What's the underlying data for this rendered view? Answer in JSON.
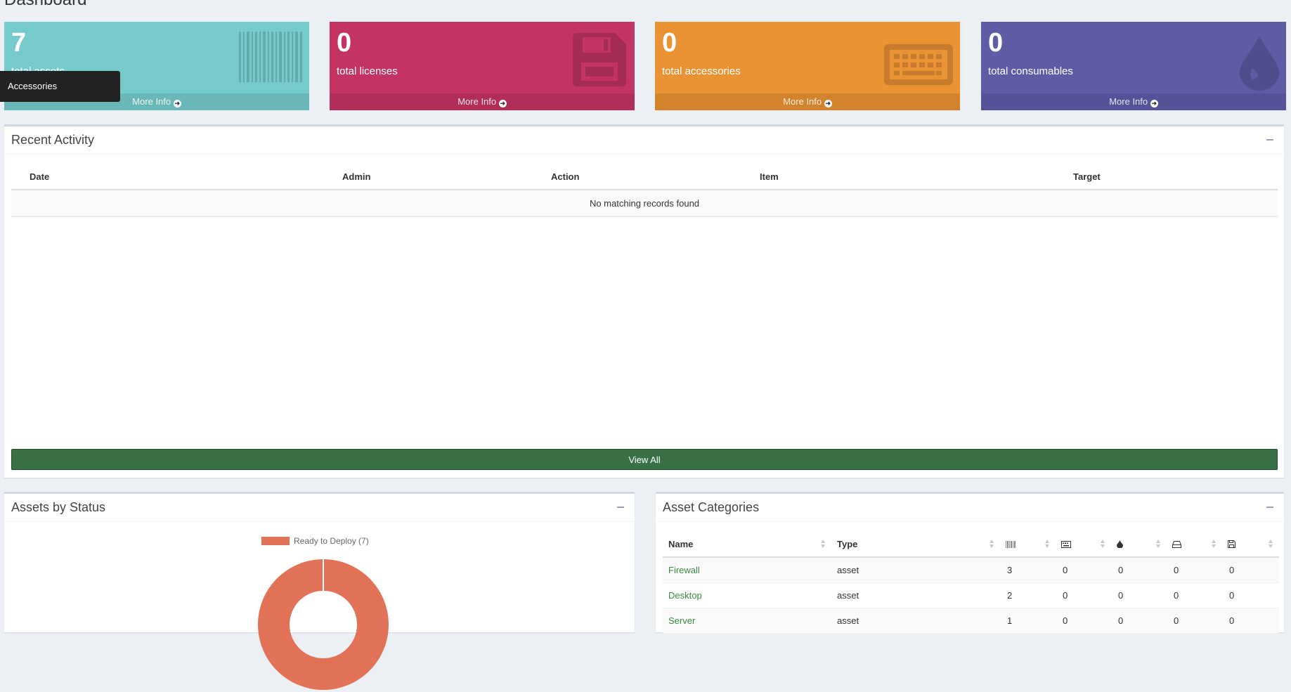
{
  "page": {
    "title": "Dashboard"
  },
  "tooltip": {
    "text": "Accessories"
  },
  "stats": [
    {
      "value": "7",
      "label": "total assets",
      "more": "More Info",
      "color": "#75cbcb",
      "icon": "barcode-icon"
    },
    {
      "value": "0",
      "label": "total licenses",
      "more": "More Info",
      "color": "#c33462",
      "icon": "floppy-disk-icon"
    },
    {
      "value": "0",
      "label": "total accessories",
      "more": "More Info",
      "color": "#ea9335",
      "icon": "keyboard-icon"
    },
    {
      "value": "0",
      "label": "total consumables",
      "more": "More Info",
      "color": "#5f5ca6",
      "icon": "tint-drop-icon"
    }
  ],
  "recent_activity": {
    "title": "Recent Activity",
    "columns": [
      "Date",
      "Admin",
      "Action",
      "Item",
      "Target"
    ],
    "empty_text": "No matching records found",
    "view_all": "View All",
    "view_all_color": "#3a7045"
  },
  "assets_by_status": {
    "title": "Assets by Status",
    "chart_data": {
      "type": "pie",
      "categories": [
        "Ready to Deploy (7)"
      ],
      "values": [
        7
      ],
      "colors": [
        "#e27257"
      ],
      "legend": "top"
    }
  },
  "asset_categories": {
    "title": "Asset Categories",
    "columns": {
      "name": "Name",
      "type": "Type"
    },
    "icon_columns": [
      "barcode-icon",
      "keyboard-icon",
      "tint-drop-icon",
      "hard-drive-icon",
      "floppy-disk-icon"
    ],
    "rows": [
      {
        "name": "Firewall",
        "type": "asset",
        "counts": [
          "3",
          "0",
          "0",
          "0",
          "0"
        ]
      },
      {
        "name": "Desktop",
        "type": "asset",
        "counts": [
          "2",
          "0",
          "0",
          "0",
          "0"
        ]
      },
      {
        "name": "Server",
        "type": "asset",
        "counts": [
          "1",
          "0",
          "0",
          "0",
          "0"
        ]
      }
    ]
  }
}
